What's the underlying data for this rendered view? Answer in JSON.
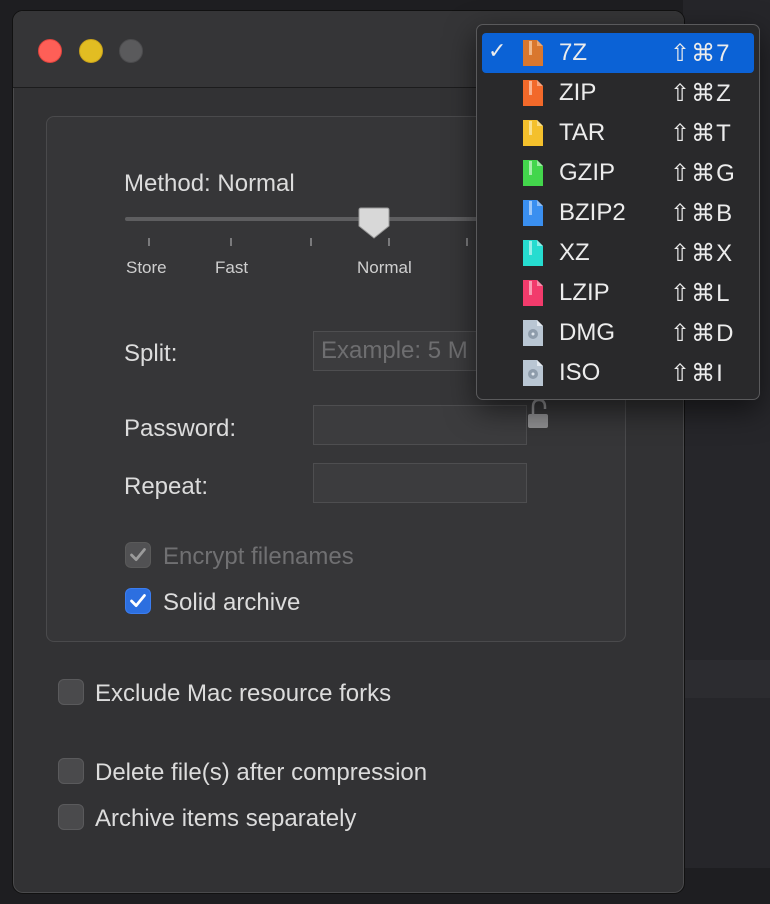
{
  "window": {
    "controls": [
      "close",
      "minimize",
      "zoom"
    ]
  },
  "compression": {
    "method_label": "Method: Normal",
    "levels": [
      "Store",
      "Fast",
      "Normal"
    ],
    "selected_level": "Normal"
  },
  "split": {
    "label": "Split:",
    "placeholder": "Example: 5 M"
  },
  "password": {
    "label": "Password:",
    "repeat_label": "Repeat:",
    "lock_icon": "lock-open-icon"
  },
  "options": {
    "encrypt_filenames": {
      "label": "Encrypt filenames",
      "checked": true,
      "enabled": false
    },
    "solid_archive": {
      "label": "Solid archive",
      "checked": true,
      "enabled": true
    },
    "exclude_forks": {
      "label": "Exclude Mac resource forks",
      "checked": false
    },
    "delete_after": {
      "label": "Delete file(s) after compression",
      "checked": false
    },
    "separate": {
      "label": "Archive items separately",
      "checked": false
    }
  },
  "format_menu": {
    "selected": "7Z",
    "items": [
      {
        "name": "7Z",
        "shortcut": "⇧⌘7",
        "color": "#d9772e",
        "icon": "archive-file-icon"
      },
      {
        "name": "ZIP",
        "shortcut": "⇧⌘Z",
        "color": "#f2692a",
        "icon": "archive-file-icon"
      },
      {
        "name": "TAR",
        "shortcut": "⇧⌘T",
        "color": "#f4c02c",
        "icon": "archive-file-icon"
      },
      {
        "name": "GZIP",
        "shortcut": "⇧⌘G",
        "color": "#43d64c",
        "icon": "archive-file-icon"
      },
      {
        "name": "BZIP2",
        "shortcut": "⇧⌘B",
        "color": "#3a8ff0",
        "icon": "archive-file-icon"
      },
      {
        "name": "XZ",
        "shortcut": "⇧⌘X",
        "color": "#26dcd0",
        "icon": "archive-file-icon"
      },
      {
        "name": "LZIP",
        "shortcut": "⇧⌘L",
        "color": "#f23b6c",
        "icon": "archive-file-icon"
      },
      {
        "name": "DMG",
        "shortcut": "⇧⌘D",
        "color": "#b9c6d3",
        "icon": "disk-image-icon"
      },
      {
        "name": "ISO",
        "shortcut": "⇧⌘I",
        "color": "#b9c6d3",
        "icon": "disk-image-icon"
      }
    ]
  }
}
